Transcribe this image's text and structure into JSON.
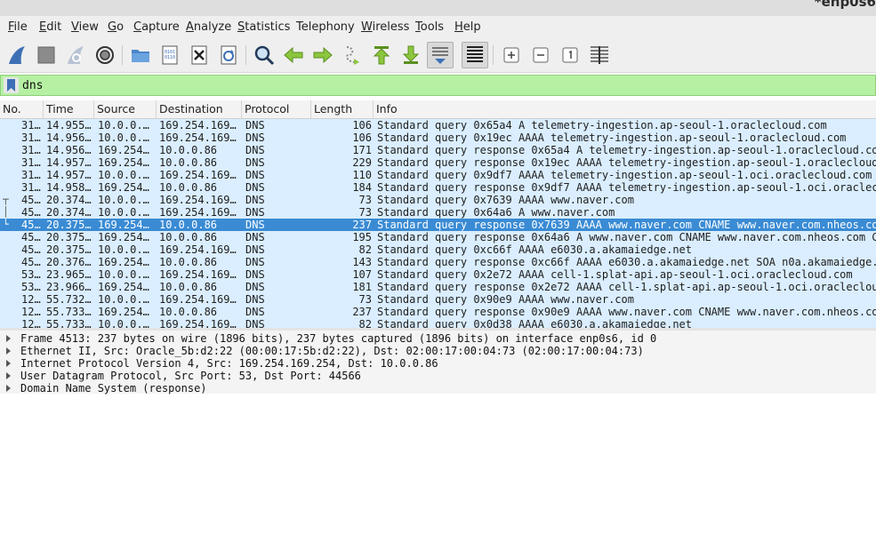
{
  "window": {
    "title": "*enp0s6"
  },
  "menu": [
    {
      "label": "File",
      "u": "F",
      "rest": "ile"
    },
    {
      "label": "Edit",
      "u": "E",
      "rest": "dit"
    },
    {
      "label": "View",
      "u": "V",
      "rest": "iew"
    },
    {
      "label": "Go",
      "u": "G",
      "rest": "o"
    },
    {
      "label": "Capture",
      "u": "C",
      "rest": "apture"
    },
    {
      "label": "Analyze",
      "u": "A",
      "rest": "nalyze"
    },
    {
      "label": "Statistics",
      "u": "S",
      "rest": "tatistics"
    },
    {
      "label": "Telephony",
      "u": "",
      "rest": "Telephony"
    },
    {
      "label": "Wireless",
      "u": "W",
      "rest": "ireless"
    },
    {
      "label": "Tools",
      "u": "T",
      "rest": "ools"
    },
    {
      "label": "Help",
      "u": "H",
      "rest": "elp"
    }
  ],
  "toolbar": {
    "icons": [
      "shark-fin-start-icon",
      "stop-square-icon",
      "restart-fin-icon",
      "gear-options-icon",
      "folder-open-icon",
      "file-binary-icon",
      "file-close-icon",
      "reload-file-icon",
      "search-icon",
      "arrow-left-icon",
      "arrow-right-icon",
      "go-to-packet-icon",
      "go-first-icon",
      "go-last-icon",
      "autoscroll-icon",
      "colorize-icon",
      "zoom-in-icon",
      "zoom-out-icon",
      "zoom-normal-icon",
      "resize-columns-icon"
    ]
  },
  "filter": {
    "value": "dns"
  },
  "columns": [
    "No.",
    "Time",
    "Source",
    "Destination",
    "Protocol",
    "Length",
    "Info"
  ],
  "packets": [
    {
      "no": "31…",
      "time": "14.955…",
      "src": "10.0.0.…",
      "dst": "169.254.169…",
      "proto": "DNS",
      "len": "106",
      "info": "Standard query 0x65a4 A telemetry-ingestion.ap-seoul-1.oraclecloud.com",
      "mark": ""
    },
    {
      "no": "31…",
      "time": "14.956…",
      "src": "10.0.0.…",
      "dst": "169.254.169…",
      "proto": "DNS",
      "len": "106",
      "info": "Standard query 0x19ec AAAA telemetry-ingestion.ap-seoul-1.oraclecloud.com",
      "mark": ""
    },
    {
      "no": "31…",
      "time": "14.956…",
      "src": "169.254…",
      "dst": "10.0.0.86",
      "proto": "DNS",
      "len": "171",
      "info": "Standard query response 0x65a4 A telemetry-ingestion.ap-seoul-1.oraclecloud.co",
      "mark": ""
    },
    {
      "no": "31…",
      "time": "14.957…",
      "src": "169.254…",
      "dst": "10.0.0.86",
      "proto": "DNS",
      "len": "229",
      "info": "Standard query response 0x19ec AAAA telemetry-ingestion.ap-seoul-1.oraclecloud",
      "mark": ""
    },
    {
      "no": "31…",
      "time": "14.957…",
      "src": "10.0.0.…",
      "dst": "169.254.169…",
      "proto": "DNS",
      "len": "110",
      "info": "Standard query 0x9df7 AAAA telemetry-ingestion.ap-seoul-1.oci.oraclecloud.com",
      "mark": ""
    },
    {
      "no": "31…",
      "time": "14.958…",
      "src": "169.254…",
      "dst": "10.0.0.86",
      "proto": "DNS",
      "len": "184",
      "info": "Standard query response 0x9df7 AAAA telemetry-ingestion.ap-seoul-1.oci.oraclec",
      "mark": ""
    },
    {
      "no": "45…",
      "time": "20.374…",
      "src": "10.0.0.…",
      "dst": "169.254.169…",
      "proto": "DNS",
      "len": "73",
      "info": "Standard query 0x7639 AAAA www.naver.com",
      "mark": "┬"
    },
    {
      "no": "45…",
      "time": "20.374…",
      "src": "10.0.0.…",
      "dst": "169.254.169…",
      "proto": "DNS",
      "len": "73",
      "info": "Standard query 0x64a6 A www.naver.com",
      "mark": "│"
    },
    {
      "no": "45…",
      "time": "20.375…",
      "src": "169.254…",
      "dst": "10.0.0.86",
      "proto": "DNS",
      "len": "237",
      "info": "Standard query response 0x7639 AAAA www.naver.com CNAME www.naver.com.nheos.co",
      "mark": "└"
    },
    {
      "no": "45…",
      "time": "20.375…",
      "src": "169.254…",
      "dst": "10.0.0.86",
      "proto": "DNS",
      "len": "195",
      "info": "Standard query response 0x64a6 A www.naver.com CNAME www.naver.com.nheos.com C",
      "mark": ""
    },
    {
      "no": "45…",
      "time": "20.375…",
      "src": "10.0.0.…",
      "dst": "169.254.169…",
      "proto": "DNS",
      "len": "82",
      "info": "Standard query 0xc66f AAAA e6030.a.akamaiedge.net",
      "mark": ""
    },
    {
      "no": "45…",
      "time": "20.376…",
      "src": "169.254…",
      "dst": "10.0.0.86",
      "proto": "DNS",
      "len": "143",
      "info": "Standard query response 0xc66f AAAA e6030.a.akamaiedge.net SOA n0a.akamaiedge.",
      "mark": ""
    },
    {
      "no": "53…",
      "time": "23.965…",
      "src": "10.0.0.…",
      "dst": "169.254.169…",
      "proto": "DNS",
      "len": "107",
      "info": "Standard query 0x2e72 AAAA cell-1.splat-api.ap-seoul-1.oci.oraclecloud.com",
      "mark": ""
    },
    {
      "no": "53…",
      "time": "23.966…",
      "src": "169.254…",
      "dst": "10.0.0.86",
      "proto": "DNS",
      "len": "181",
      "info": "Standard query response 0x2e72 AAAA cell-1.splat-api.ap-seoul-1.oci.oraclecloud",
      "mark": ""
    },
    {
      "no": "12…",
      "time": "55.732…",
      "src": "10.0.0.…",
      "dst": "169.254.169…",
      "proto": "DNS",
      "len": "73",
      "info": "Standard query 0x90e9 AAAA www.naver.com",
      "mark": ""
    },
    {
      "no": "12…",
      "time": "55.733…",
      "src": "169.254…",
      "dst": "10.0.0.86",
      "proto": "DNS",
      "len": "237",
      "info": "Standard query response 0x90e9 AAAA www.naver.com CNAME www.naver.com.nheos.co",
      "mark": ""
    },
    {
      "no": "12…",
      "time": "55.733…",
      "src": "10.0.0.…",
      "dst": "169.254.169…",
      "proto": "DNS",
      "len": "82",
      "info": "Standard query 0x0d38 AAAA e6030.a.akamaiedge.net",
      "mark": ""
    }
  ],
  "selected_index": 8,
  "details": [
    "Frame 4513: 237 bytes on wire (1896 bits), 237 bytes captured (1896 bits) on interface enp0s6, id 0",
    "Ethernet II, Src: Oracle_5b:d2:22 (00:00:17:5b:d2:22), Dst: 02:00:17:00:04:73 (02:00:17:00:04:73)",
    "Internet Protocol Version 4, Src: 169.254.169.254, Dst: 10.0.0.86",
    "User Datagram Protocol, Src Port: 53, Dst Port: 44566",
    "Domain Name System (response)"
  ],
  "colors": {
    "row_bg": "#daeeff",
    "selected_bg": "#3a8bd4",
    "filter_bg": "#b6f0a3"
  }
}
